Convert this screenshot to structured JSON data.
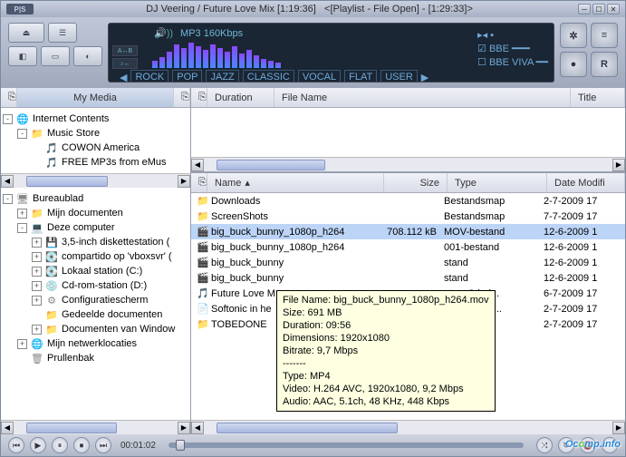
{
  "titlebar": {
    "logo": "P|S",
    "track": "DJ Veering / Future Love Mix  [1:19:36]",
    "sep": "<",
    "playlist": "[Playlist - File Open] - [1:29:33]",
    "sep2": ">"
  },
  "display": {
    "codec": "MP3 160Kbps",
    "eq_presets": [
      "ROCK",
      "POP",
      "JAZZ",
      "CLASSIC",
      "VOCAL",
      "FLAT",
      "USER"
    ],
    "mini_btns": [
      "A↔B",
      "♪↔"
    ],
    "bbe": "BBE",
    "viva": "BBE VIVA",
    "spectrum": [
      8,
      12,
      18,
      26,
      22,
      28,
      24,
      20,
      26,
      22,
      18,
      24,
      16,
      20,
      14,
      10,
      8,
      6
    ]
  },
  "left_header": "My Media",
  "tree1": [
    {
      "ind": 0,
      "exp": "-",
      "icon": "🌐",
      "label": "Internet Contents",
      "cls": "folder-ico"
    },
    {
      "ind": 1,
      "exp": "-",
      "icon": "📁",
      "label": "Music Store",
      "cls": "folder-ico"
    },
    {
      "ind": 2,
      "exp": "",
      "icon": "🎵",
      "label": "COWON America",
      "cls": "file-ico"
    },
    {
      "ind": 2,
      "exp": "",
      "icon": "🎵",
      "label": "FREE MP3s from eMus",
      "cls": "file-ico"
    }
  ],
  "tree2": [
    {
      "ind": 0,
      "exp": "-",
      "icon": "🖥",
      "label": "Bureaublad",
      "cls": "drive-ico"
    },
    {
      "ind": 1,
      "exp": "+",
      "icon": "📁",
      "label": "Mijn documenten",
      "cls": "folder-ico"
    },
    {
      "ind": 1,
      "exp": "-",
      "icon": "💻",
      "label": "Deze computer",
      "cls": "drive-ico"
    },
    {
      "ind": 2,
      "exp": "+",
      "icon": "💾",
      "label": "3,5-inch diskettestation (",
      "cls": "drive-ico"
    },
    {
      "ind": 2,
      "exp": "+",
      "icon": "💽",
      "label": "compartido op 'vboxsvr' (",
      "cls": "drive-ico"
    },
    {
      "ind": 2,
      "exp": "+",
      "icon": "💽",
      "label": "Lokaal station (C:)",
      "cls": "drive-ico"
    },
    {
      "ind": 2,
      "exp": "+",
      "icon": "💿",
      "label": "Cd-rom-station (D:)",
      "cls": "drive-ico"
    },
    {
      "ind": 2,
      "exp": "+",
      "icon": "⚙",
      "label": "Configuratiescherm",
      "cls": "drive-ico"
    },
    {
      "ind": 2,
      "exp": "",
      "icon": "📁",
      "label": "Gedeelde documenten",
      "cls": "folder-ico"
    },
    {
      "ind": 2,
      "exp": "+",
      "icon": "📁",
      "label": "Documenten van Window",
      "cls": "folder-ico"
    },
    {
      "ind": 1,
      "exp": "+",
      "icon": "🌐",
      "label": "Mijn netwerklocaties",
      "cls": "file-ico"
    },
    {
      "ind": 1,
      "exp": "",
      "icon": "🗑",
      "label": "Prullenbak",
      "cls": "drive-ico"
    }
  ],
  "playlist_cols": {
    "duration": "Duration",
    "filename": "File Name",
    "title": "Title"
  },
  "file_cols": {
    "name": "Name",
    "size": "Size",
    "type": "Type",
    "date": "Date Modifi"
  },
  "files": [
    {
      "icon": "📁",
      "name": "Downloads",
      "size": "",
      "type": "Bestandsmap",
      "date": "2-7-2009 17",
      "cls": "folder-ico"
    },
    {
      "icon": "📁",
      "name": "ScreenShots",
      "size": "",
      "type": "Bestandsmap",
      "date": "7-7-2009 17",
      "cls": "folder-ico"
    },
    {
      "icon": "🎬",
      "name": "big_buck_bunny_1080p_h264",
      "size": "708.112 kB",
      "type": "MOV-bestand",
      "date": "12-6-2009 1",
      "cls": "file-ico",
      "sel": true
    },
    {
      "icon": "🎬",
      "name": "big_buck_bunny_1080p_h264",
      "size": "",
      "type": "001-bestand",
      "date": "12-6-2009 1",
      "cls": "file-ico"
    },
    {
      "icon": "🎬",
      "name": "big_buck_bunny",
      "size": "",
      "type": "stand",
      "date": "12-6-2009 1",
      "cls": "file-ico"
    },
    {
      "icon": "🎬",
      "name": "big_buck_bunny",
      "size": "",
      "type": "stand",
      "date": "12-6-2009 1",
      "cls": "file-ico"
    },
    {
      "icon": "🎵",
      "name": "Future Love M",
      "size": "",
      "type": "et mp3-ind...",
      "date": "6-7-2009 17",
      "cls": "file-ico"
    },
    {
      "icon": "📄",
      "name": "Softonic in he",
      "size": "",
      "type": "t Word Doc...",
      "date": "2-7-2009 17",
      "cls": "file-ico"
    },
    {
      "icon": "📁",
      "name": "TOBEDONE",
      "size": "",
      "type": "",
      "date": "2-7-2009 17",
      "cls": "folder-ico"
    }
  ],
  "tooltip": {
    "l1": "File Name: big_buck_bunny_1080p_h264.mov",
    "l2": "Size: 691 MB",
    "l3": "Duration: 09:56",
    "l4": "Dimensions: 1920x1080",
    "l5": "Bitrate: 9,7 Mbps",
    "l6": "-------",
    "l7": "Type: MP4",
    "l8": "Video: H.264 AVC, 1920x1080, 9,2 Mbps",
    "l9": "Audio: AAC, 5.1ch, 48 KHz, 448 Kbps"
  },
  "controls": {
    "time": "00:01:02"
  },
  "watermark": {
    "a": "Oc",
    "b": "o",
    "c": "mp.info"
  }
}
